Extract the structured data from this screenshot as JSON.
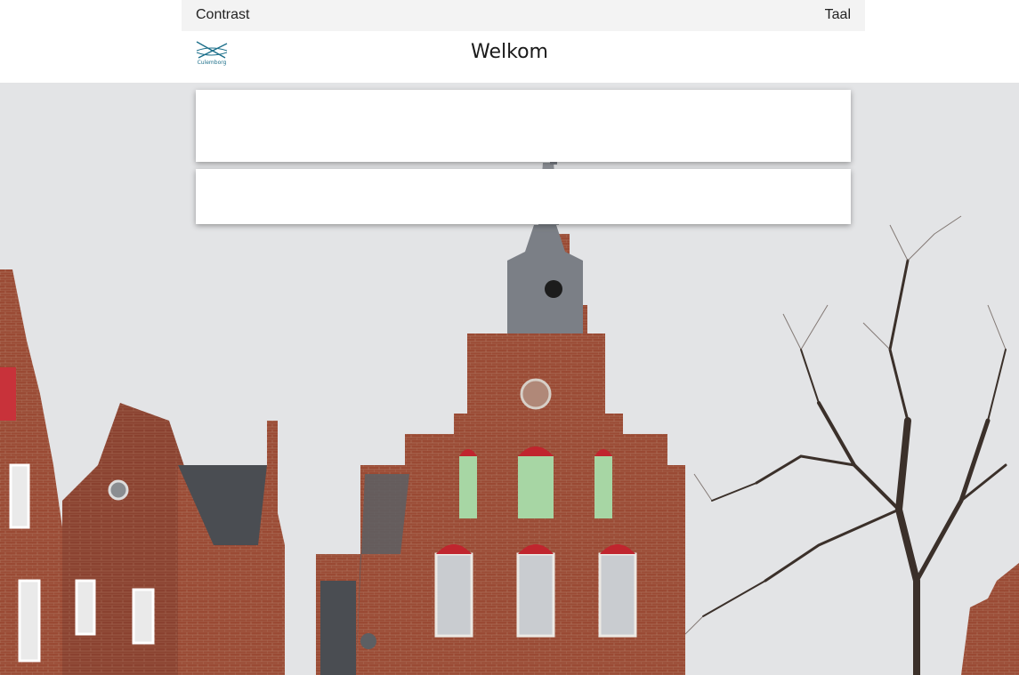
{
  "topbar": {
    "contrast_label": "Contrast",
    "language_label": "Taal"
  },
  "header": {
    "logo_text": "Culemborg",
    "title": "Welkom"
  },
  "hero": {
    "image_description_icon": "town-hall-photo"
  },
  "colors": {
    "brick": "#9a4a34",
    "brick_dark": "#7a3826",
    "sky": "#e2e3e5",
    "logo_blue": "#1c6f8a"
  }
}
